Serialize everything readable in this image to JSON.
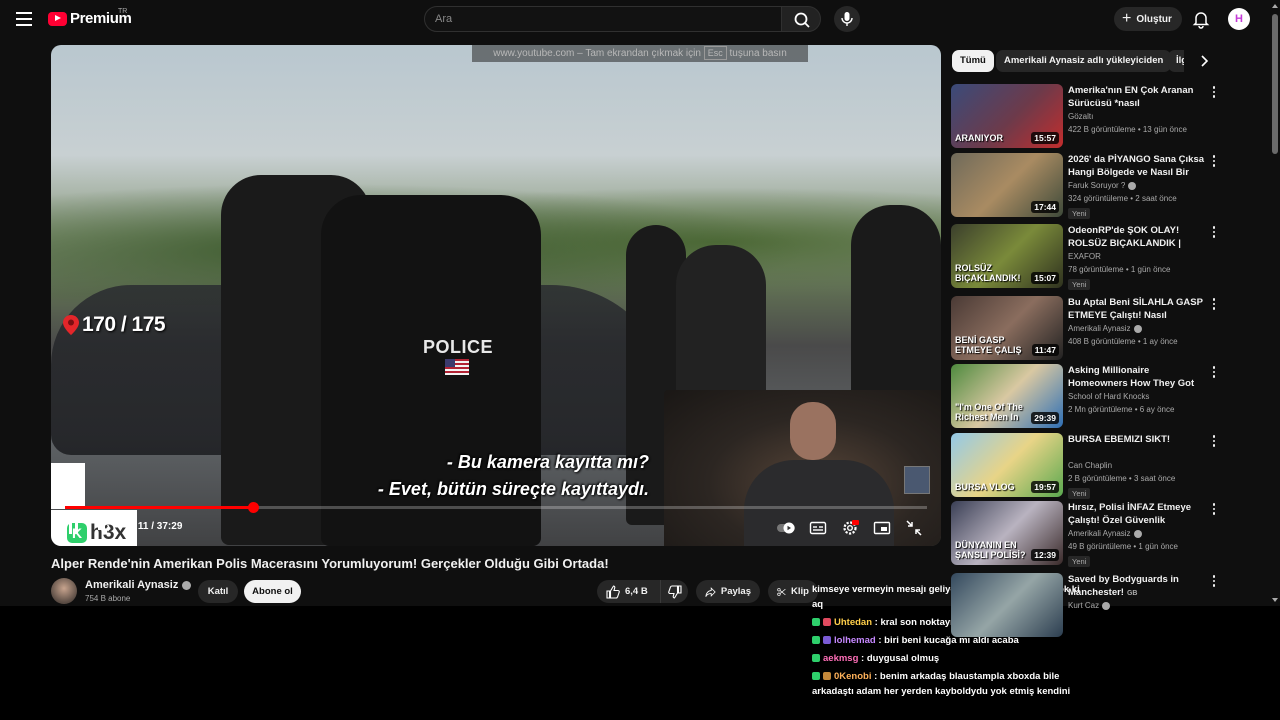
{
  "header": {
    "logo_text": "Premium",
    "region": "TR",
    "search_placeholder": "Ara",
    "create_label": "Oluştur",
    "avatar_letter": "H"
  },
  "player": {
    "fullscreen_notice_prefix": "www.youtube.com – Tam ekrandan çıkmak için",
    "fullscreen_notice_key": "Esc",
    "fullscreen_notice_suffix": "tuşuna basın",
    "counter": "170 / 175",
    "police_text": "POLICE",
    "watermark": "h3x",
    "watermark_k": "K",
    "subtitle_line1": "- Bu kamera kayıtta mı?",
    "subtitle_line2": "- Evet, bütün süreçte kayıttaydı.",
    "time": "8:11 / 37:29",
    "progress": 0.218
  },
  "video": {
    "title": "Alper Rende'nin Amerikan Polis Macerasını Yorumluyorum! Gerçekler Olduğu Gibi Ortada!",
    "channel": "Amerikali Aynasiz",
    "subscribers": "754 B abone",
    "join_label": "Katıl",
    "subscribe_label": "Abone ol",
    "likes": "6,4 B",
    "share_label": "Paylaş",
    "clip_label": "Klip"
  },
  "chat": {
    "overlap_text": "kimseye vermeyin mesajı geliyo benim gide nesadim yok ki aq",
    "messages": [
      {
        "user": "Uhtedan",
        "text": ": kral son noktayı koymuş"
      },
      {
        "user": "lolhemad",
        "text": ": biri beni kucağa mı aldı acaba"
      },
      {
        "user": "aekmsg",
        "text": ": duygusal olmuş"
      },
      {
        "user": "0Kenobi",
        "text": ": benim arkadaş blaustampla xboxda bile arkadaştı adam her yerden kayboldydu yok etmiş kendini"
      }
    ]
  },
  "sidebar": {
    "chips": [
      "Tümü",
      "Amerikali Aynasiz adlı yükleyiciden",
      "İlgili"
    ],
    "recommendations": [
      {
        "title": "Amerika'nın EN Çok Aranan Sürücüsü *nasıl yakalanmıyor?*",
        "channel": "Gözaltı",
        "verified": false,
        "meta": "422 B görüntüleme • 13 gün önce",
        "duration": "15:57",
        "badge": "",
        "thumb_text": "ARANIYOR"
      },
      {
        "title": "2026' da PİYANGO Sana Çıksa Hangi Bölgede ve Nasıl Bir Evd...",
        "channel": "Faruk Soruyor ?",
        "verified": true,
        "meta": "324 görüntüleme • 2 saat önce",
        "duration": "17:44",
        "badge": "Yeni",
        "thumb_text": ""
      },
      {
        "title": "OdeonRP'de ŞOK OLAY! ROLSÜZ BIÇAKLANDIK | Five...",
        "channel": "EXAFOR",
        "verified": false,
        "meta": "78 görüntüleme • 1 gün önce",
        "duration": "15:07",
        "badge": "Yeni",
        "thumb_text": "ROLSÜZ BIÇAKLANDIK!"
      },
      {
        "title": "Bu Aptal Beni SİLAHLA GASP ETMEYE Çalıştı! Nasıl Kendimi...",
        "channel": "Amerikali Aynasiz",
        "verified": true,
        "meta": "408 B görüntüleme • 1 ay önce",
        "duration": "11:47",
        "badge": "",
        "thumb_text": "BENİ GASP ETMEYE ÇALIŞ"
      },
      {
        "title": "Asking Millionaire Homeowners How They Got Rich",
        "channel": "School of Hard Knocks",
        "verified": false,
        "meta": "2 Mn görüntüleme • 6 ay önce",
        "duration": "29:39",
        "badge": "",
        "thumb_text": "\"I'm One Of The Richest Men In FL\""
      },
      {
        "title": "BURSA EBEMIZI SIKT!",
        "channel": "Can Chaplin",
        "verified": false,
        "meta": "2 B görüntüleme • 3 saat önce",
        "duration": "19:57",
        "badge": "Yeni",
        "thumb_text": "BURSA VLOG"
      },
      {
        "title": "Hırsız, Polisi İNFAZ Etmeye Çalıştı! Özel Güvenlik HERKESİ...",
        "channel": "Amerikali Aynasiz",
        "verified": true,
        "meta": "49 B görüntüleme • 1 gün önce",
        "duration": "12:39",
        "badge": "Yeni",
        "thumb_text": "DÜNYANIN EN ŞANSLI POLİSİ?"
      },
      {
        "title": "Saved by Bodyguards in Manchester!",
        "channel": "Kurt Caz",
        "verified": true,
        "meta": "",
        "duration": "",
        "badge": "",
        "thumb_text": "",
        "title_suffix": "GB"
      }
    ]
  },
  "colors": {
    "accent": "#ff0033",
    "progress": "#ff0000",
    "background": "#0f0f0f",
    "watermark_green": "#2ecf6b"
  }
}
